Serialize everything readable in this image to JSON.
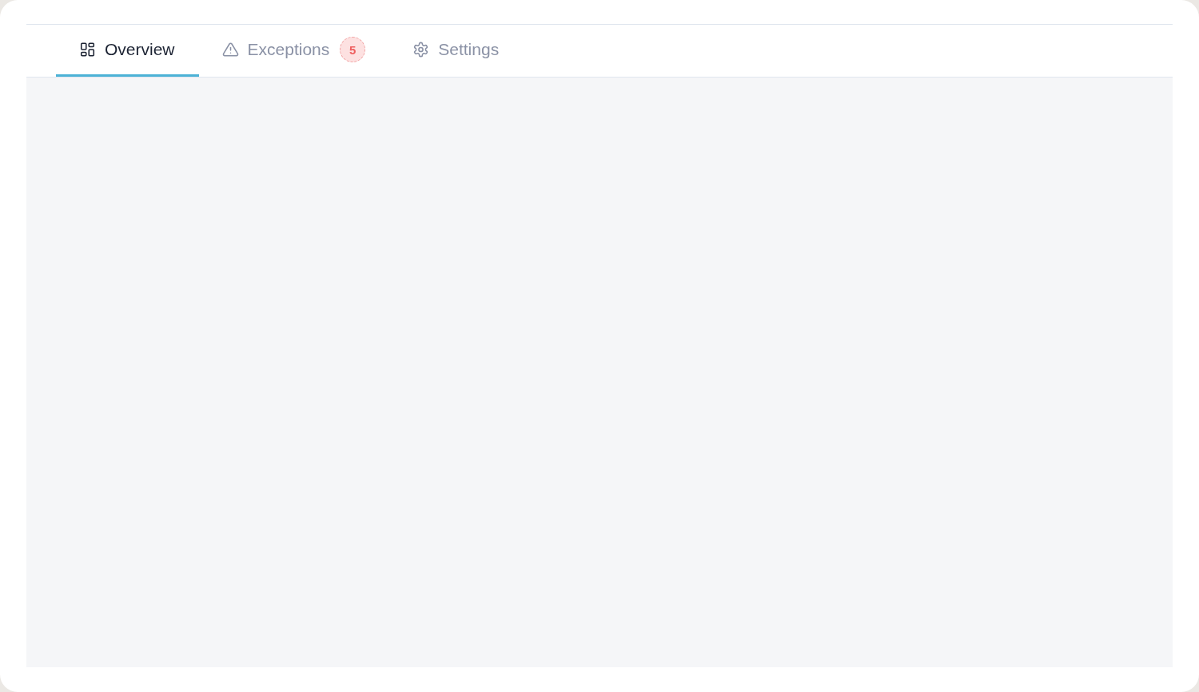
{
  "tabs": [
    {
      "kind": "dashboard",
      "label": "Overview",
      "selected": true
    },
    {
      "kind": "alerts",
      "label": "Exceptions",
      "selected": false,
      "count": "5"
    },
    {
      "kind": "settings",
      "label": "Settings",
      "selected": false
    }
  ]
}
